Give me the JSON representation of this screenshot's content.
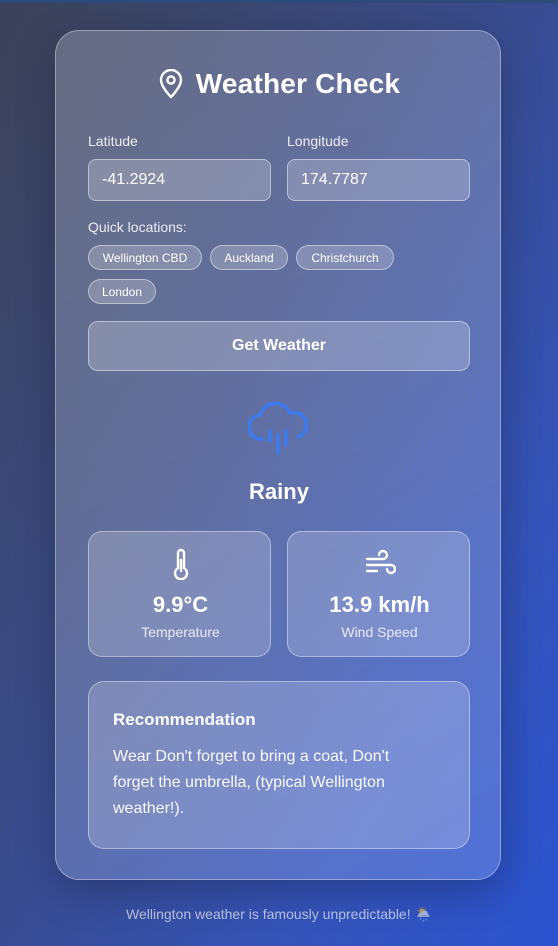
{
  "app": {
    "title": "Weather Check"
  },
  "form": {
    "latitude_label": "Latitude",
    "latitude_value": "-41.2924",
    "longitude_label": "Longitude",
    "longitude_value": "174.7787",
    "quick_label": "Quick locations:",
    "quick_locations": [
      "Wellington CBD",
      "Auckland",
      "Christchurch",
      "London"
    ],
    "submit_label": "Get Weather"
  },
  "result": {
    "condition": "Rainy",
    "condition_icon": "cloud-rain-icon",
    "temperature": {
      "value": "9.9°C",
      "label": "Temperature",
      "icon": "thermometer-icon"
    },
    "wind": {
      "value": "13.9 km/h",
      "label": "Wind Speed",
      "icon": "wind-icon"
    }
  },
  "recommendation": {
    "title": "Recommendation",
    "text": "Wear Don't forget to bring a coat, Don't forget the umbrella, (typical Wellington weather!)."
  },
  "footer": {
    "text": "Wellington weather is famously unpredictable! 🌦️"
  },
  "colors": {
    "accent_icon": "#3b7bf0",
    "background_start": "#3c4257",
    "background_end": "#2b53d0"
  }
}
